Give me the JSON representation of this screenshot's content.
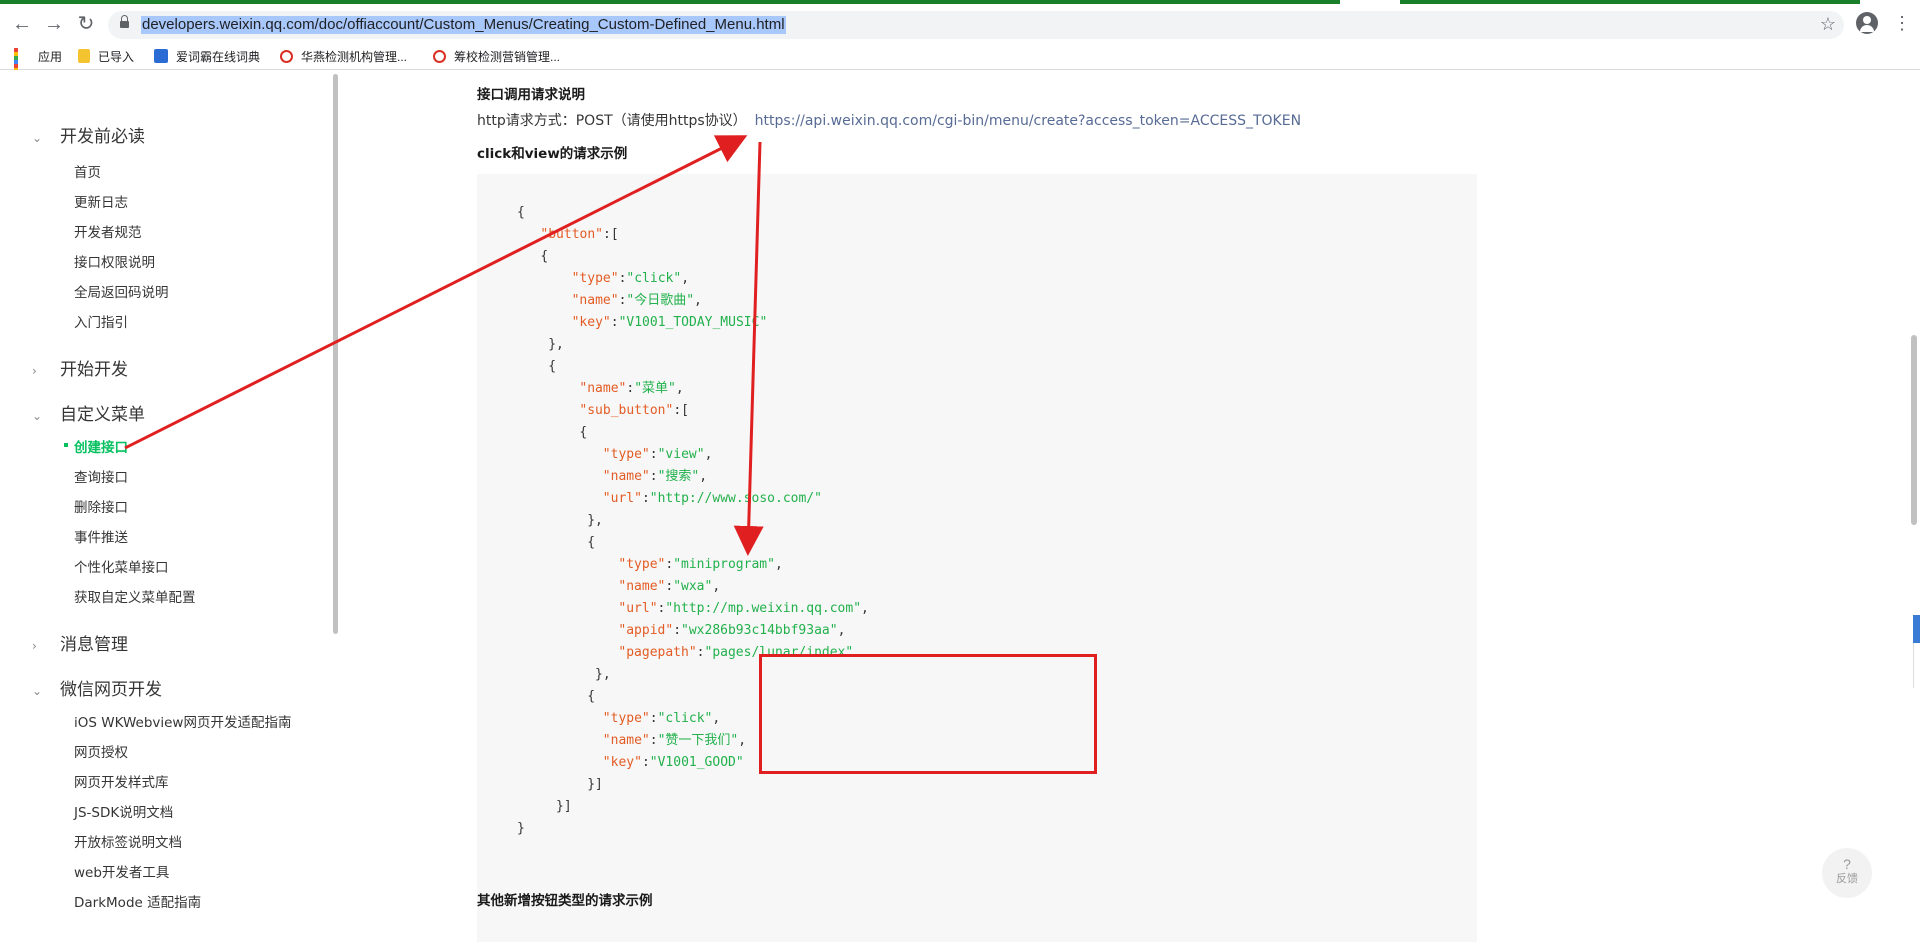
{
  "browser": {
    "url": "developers.weixin.qq.com/doc/offiaccount/Custom_Menus/Creating_Custom-Defined_Menu.html",
    "back_icon": "arrow-left-icon",
    "forward_icon": "arrow-right-icon",
    "reload_icon": "reload-icon",
    "bookmarks": [
      {
        "label": "应用",
        "icon": "apps-grid-icon"
      },
      {
        "label": "已导入",
        "icon": "folder-icon"
      },
      {
        "label": "爱词霸在线词典",
        "icon": "dictionary-icon"
      },
      {
        "label": "华燕检测机构管理...",
        "icon": "site-logo-icon"
      },
      {
        "label": "筹校检测营销管理...",
        "icon": "site-logo-icon"
      }
    ]
  },
  "sidebar": {
    "groups": [
      {
        "label": "开发前必读",
        "expanded": true,
        "items": [
          "首页",
          "更新日志",
          "开发者规范",
          "接口权限说明",
          "全局返回码说明",
          "入门指引"
        ]
      },
      {
        "label": "开始开发",
        "expanded": false,
        "items": []
      },
      {
        "label": "自定义菜单",
        "expanded": true,
        "items": [
          "创建接口",
          "查询接口",
          "删除接口",
          "事件推送",
          "个性化菜单接口",
          "获取自定义菜单配置"
        ]
      },
      {
        "label": "消息管理",
        "expanded": false,
        "items": []
      },
      {
        "label": "微信网页开发",
        "expanded": true,
        "items": [
          "iOS WKWebview网页开发适配指南",
          "网页授权",
          "网页开发样式库",
          "JS-SDK说明文档",
          "开放标签说明文档",
          "web开发者工具",
          "DarkMode 适配指南"
        ]
      }
    ],
    "active_item": "创建接口"
  },
  "main": {
    "section_title": "接口调用请求说明",
    "request_prefix": "http请求方式：POST（请使用https协议）",
    "request_url": "https://api.weixin.qq.com/cgi-bin/menu/create?access_token=ACCESS_TOKEN",
    "example_title": "click和view的请求示例",
    "bottom_title": "其他新增按钮类型的请求示例",
    "feedback_q": "?",
    "feedback_label": "反馈"
  },
  "code_lines": [
    {
      "indent": 0,
      "parts": [
        [
          "p",
          "{"
        ]
      ]
    },
    {
      "indent": 3,
      "parts": [
        [
          "k",
          "\"button\""
        ],
        [
          "p",
          ":["
        ]
      ]
    },
    {
      "indent": 3,
      "parts": [
        [
          "p",
          "{"
        ]
      ]
    },
    {
      "indent": 7,
      "parts": [
        [
          "k",
          "\"type\""
        ],
        [
          "p",
          ":"
        ],
        [
          "s",
          "\"click\""
        ],
        [
          "p",
          ","
        ]
      ]
    },
    {
      "indent": 7,
      "parts": [
        [
          "k",
          "\"name\""
        ],
        [
          "p",
          ":"
        ],
        [
          "s",
          "\"今日歌曲\""
        ],
        [
          "p",
          ","
        ]
      ]
    },
    {
      "indent": 7,
      "parts": [
        [
          "k",
          "\"key\""
        ],
        [
          "p",
          ":"
        ],
        [
          "s",
          "\"V1001_TODAY_MUSIC\""
        ]
      ]
    },
    {
      "indent": 4,
      "parts": [
        [
          "p",
          "},"
        ]
      ]
    },
    {
      "indent": 4,
      "parts": [
        [
          "p",
          "{"
        ]
      ]
    },
    {
      "indent": 8,
      "parts": [
        [
          "k",
          "\"name\""
        ],
        [
          "p",
          ":"
        ],
        [
          "s",
          "\"菜单\""
        ],
        [
          "p",
          ","
        ]
      ]
    },
    {
      "indent": 8,
      "parts": [
        [
          "k",
          "\"sub_button\""
        ],
        [
          "p",
          ":["
        ]
      ]
    },
    {
      "indent": 8,
      "parts": [
        [
          "p",
          "{"
        ]
      ]
    },
    {
      "indent": 11,
      "parts": [
        [
          "k",
          "\"type\""
        ],
        [
          "p",
          ":"
        ],
        [
          "s",
          "\"view\""
        ],
        [
          "p",
          ","
        ]
      ]
    },
    {
      "indent": 11,
      "parts": [
        [
          "k",
          "\"name\""
        ],
        [
          "p",
          ":"
        ],
        [
          "s",
          "\"搜索\""
        ],
        [
          "p",
          ","
        ]
      ]
    },
    {
      "indent": 11,
      "parts": [
        [
          "k",
          "\"url\""
        ],
        [
          "p",
          ":"
        ],
        [
          "s",
          "\"http://www.soso.com/\""
        ]
      ]
    },
    {
      "indent": 9,
      "parts": [
        [
          "p",
          "},"
        ]
      ]
    },
    {
      "indent": 9,
      "parts": [
        [
          "p",
          "{"
        ]
      ]
    },
    {
      "indent": 13,
      "parts": [
        [
          "k",
          "\"type\""
        ],
        [
          "p",
          ":"
        ],
        [
          "s",
          "\"miniprogram\""
        ],
        [
          "p",
          ","
        ]
      ]
    },
    {
      "indent": 13,
      "parts": [
        [
          "k",
          "\"name\""
        ],
        [
          "p",
          ":"
        ],
        [
          "s",
          "\"wxa\""
        ],
        [
          "p",
          ","
        ]
      ]
    },
    {
      "indent": 13,
      "parts": [
        [
          "k",
          "\"url\""
        ],
        [
          "p",
          ":"
        ],
        [
          "s",
          "\"http://mp.weixin.qq.com\""
        ],
        [
          "p",
          ","
        ]
      ]
    },
    {
      "indent": 13,
      "parts": [
        [
          "k",
          "\"appid\""
        ],
        [
          "p",
          ":"
        ],
        [
          "s",
          "\"wx286b93c14bbf93aa\""
        ],
        [
          "p",
          ","
        ]
      ]
    },
    {
      "indent": 13,
      "parts": [
        [
          "k",
          "\"pagepath\""
        ],
        [
          "p",
          ":"
        ],
        [
          "s",
          "\"pages/lunar/index\""
        ]
      ]
    },
    {
      "indent": 10,
      "parts": [
        [
          "p",
          "},"
        ]
      ]
    },
    {
      "indent": 9,
      "parts": [
        [
          "p",
          "{"
        ]
      ]
    },
    {
      "indent": 11,
      "parts": [
        [
          "k",
          "\"type\""
        ],
        [
          "p",
          ":"
        ],
        [
          "s",
          "\"click\""
        ],
        [
          "p",
          ","
        ]
      ]
    },
    {
      "indent": 11,
      "parts": [
        [
          "k",
          "\"name\""
        ],
        [
          "p",
          ":"
        ],
        [
          "s",
          "\"赞一下我们\""
        ],
        [
          "p",
          ","
        ]
      ]
    },
    {
      "indent": 11,
      "parts": [
        [
          "k",
          "\"key\""
        ],
        [
          "p",
          ":"
        ],
        [
          "s",
          "\"V1001_GOOD\""
        ]
      ]
    },
    {
      "indent": 9,
      "parts": [
        [
          "p",
          "}]"
        ]
      ]
    },
    {
      "indent": 5,
      "parts": [
        [
          "p",
          "}]"
        ]
      ]
    },
    {
      "indent": 0,
      "parts": [
        [
          "p",
          "}"
        ]
      ]
    }
  ],
  "colors": {
    "accent_green": "#07c160",
    "link": "#576b95",
    "code_key": "#e45c25",
    "code_string": "#22b14c",
    "annotation_red": "#e02020"
  }
}
